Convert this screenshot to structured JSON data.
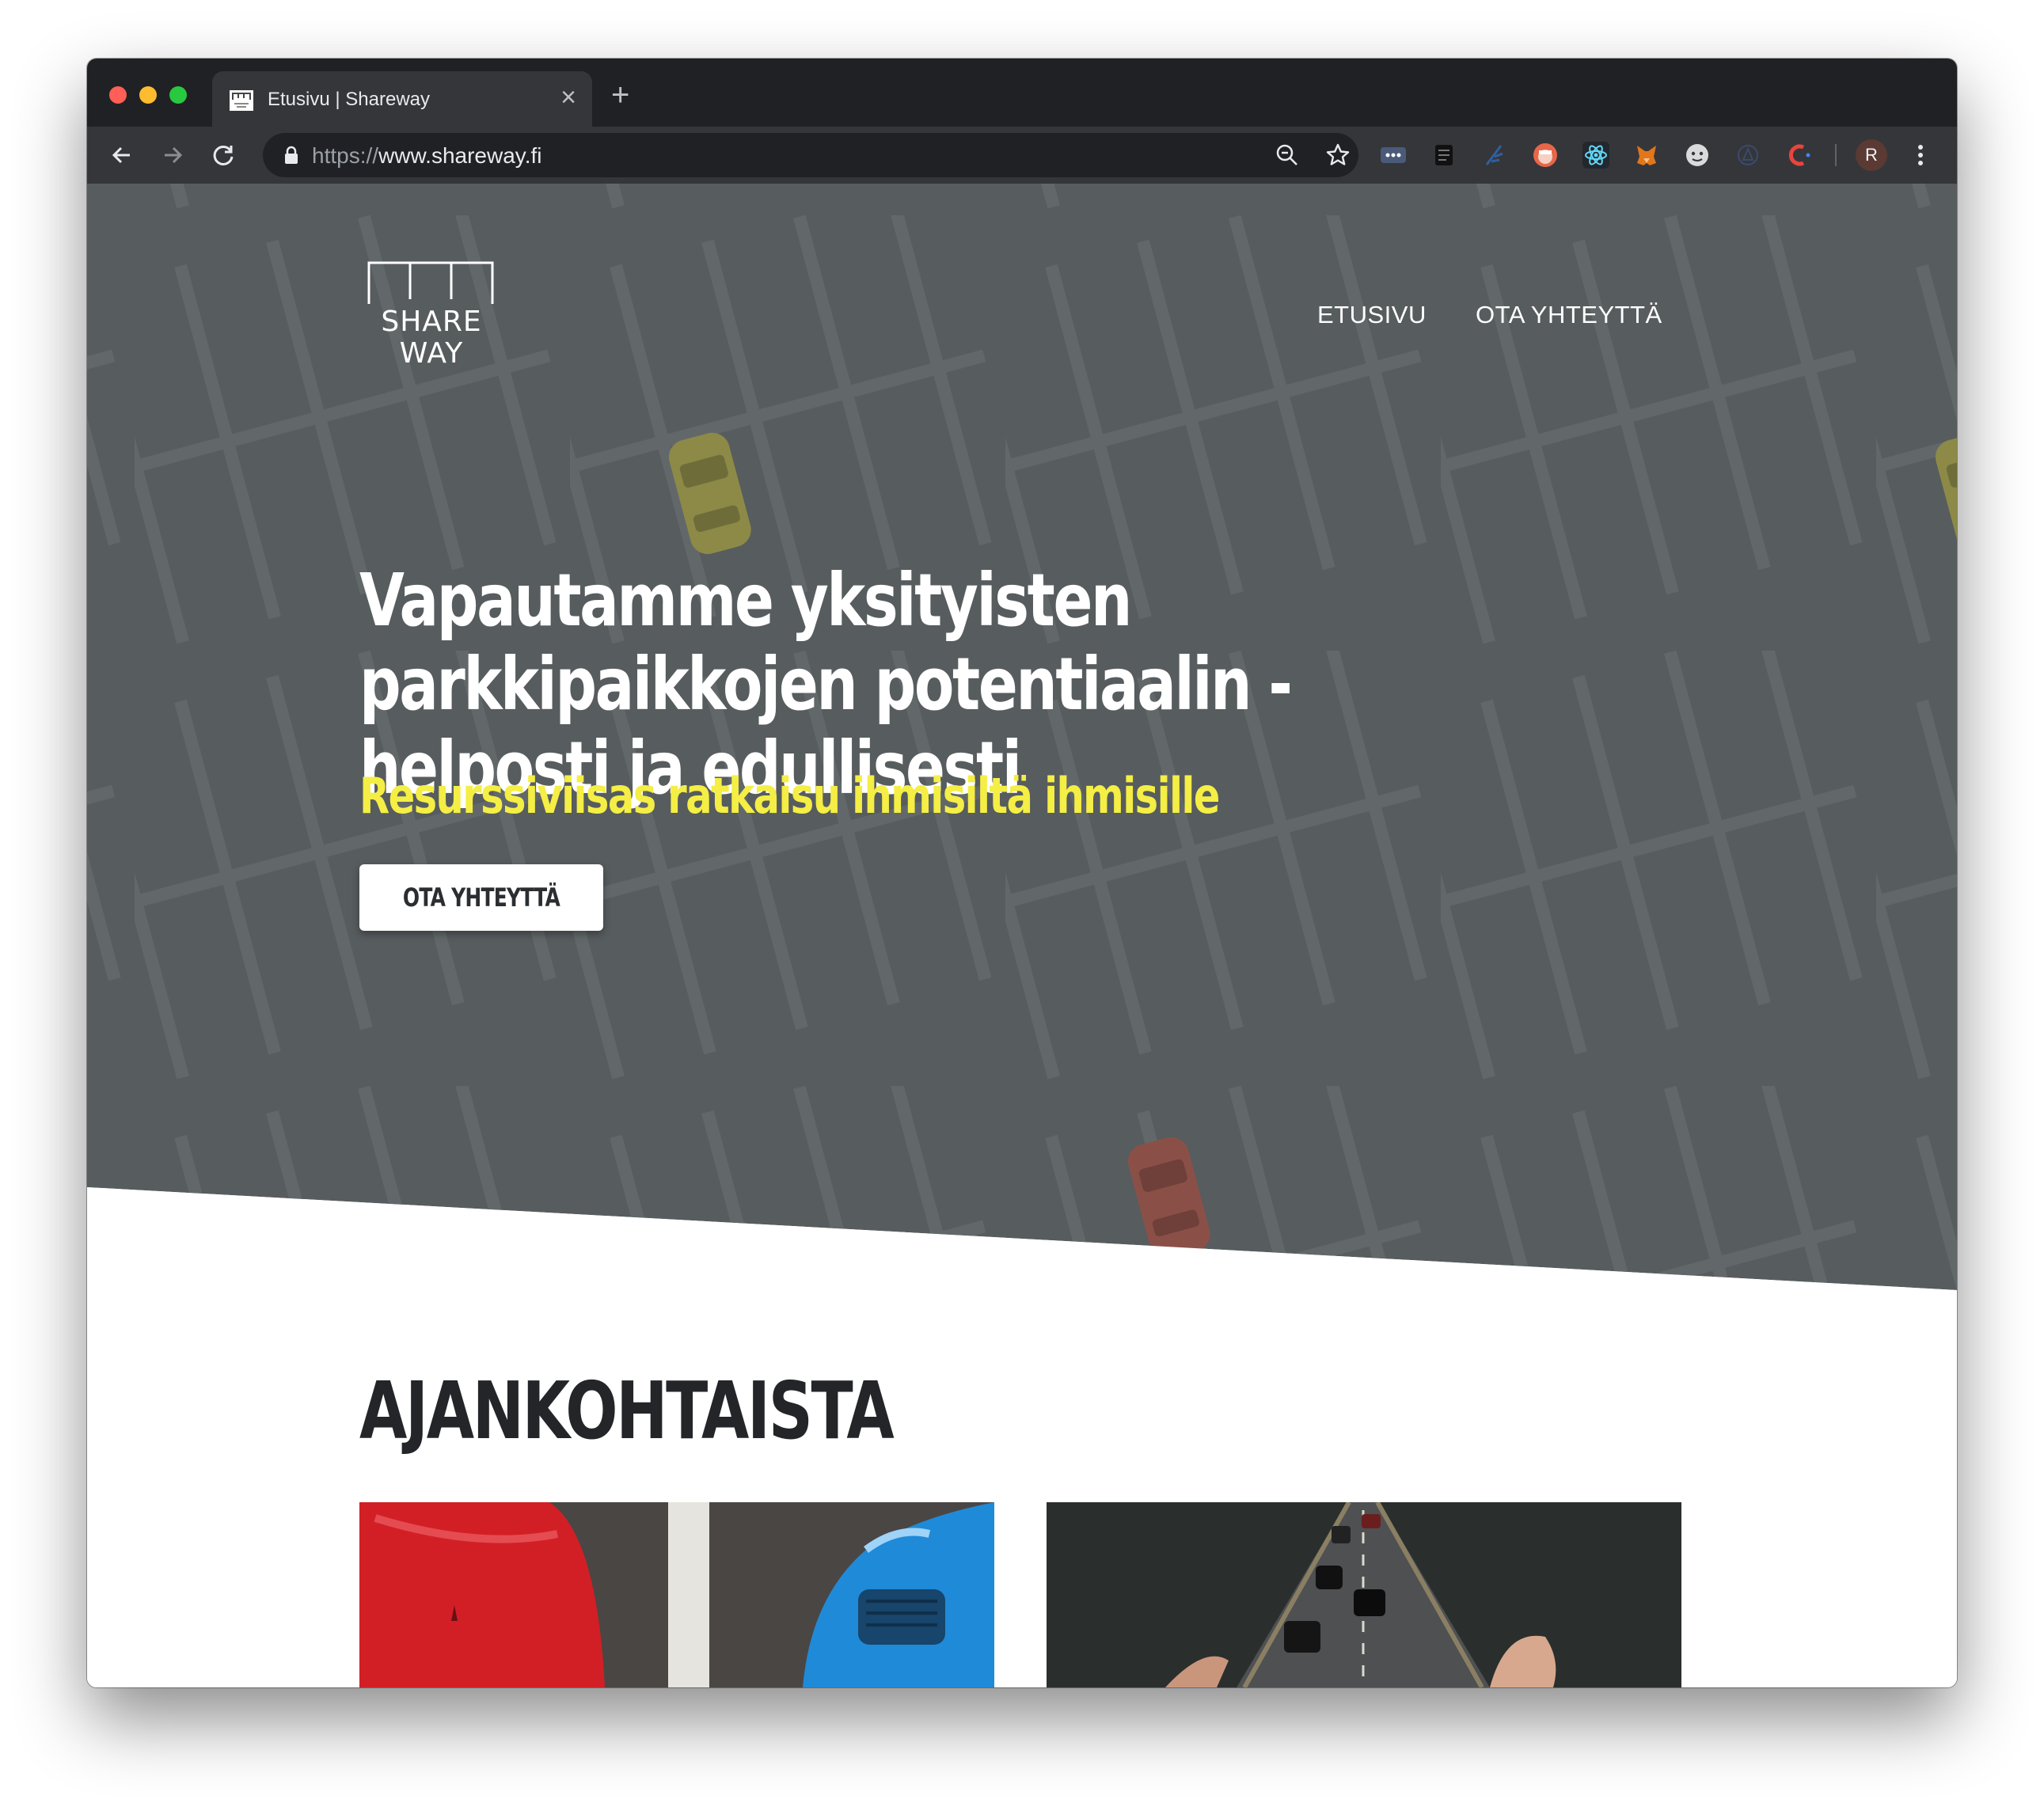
{
  "browser": {
    "tab_title": "Etusivu | Shareway",
    "new_tab_icon": "plus-icon",
    "url_scheme": "https://",
    "url_host": "www.shareway.fi",
    "profile_initial": "R"
  },
  "site": {
    "logo_line1": "SHARE",
    "logo_line2": "WAY",
    "nav": [
      {
        "label": "ETUSIVU"
      },
      {
        "label": "OTA YHTEYTTÄ"
      }
    ],
    "hero": {
      "title": "Vapautamme yksityisten parkkipaikkojen potentiaalin - helposti ja edullisesti",
      "subtitle": "Resurssiviisas ratkaisu ihmisiltä ihmisille",
      "cta_label": "OTA YHTEYTTÄ"
    },
    "news": {
      "title": "AJANKOHTAISTA",
      "cards": [
        {
          "image": "red-and-blue-cars-parked"
        },
        {
          "image": "highway-traffic-between-fingers"
        }
      ]
    }
  },
  "colors": {
    "hero_background": "#575c5e",
    "accent_yellow": "#f4ee45",
    "browser_frame": "#202124",
    "browser_toolbar": "#35363a"
  }
}
